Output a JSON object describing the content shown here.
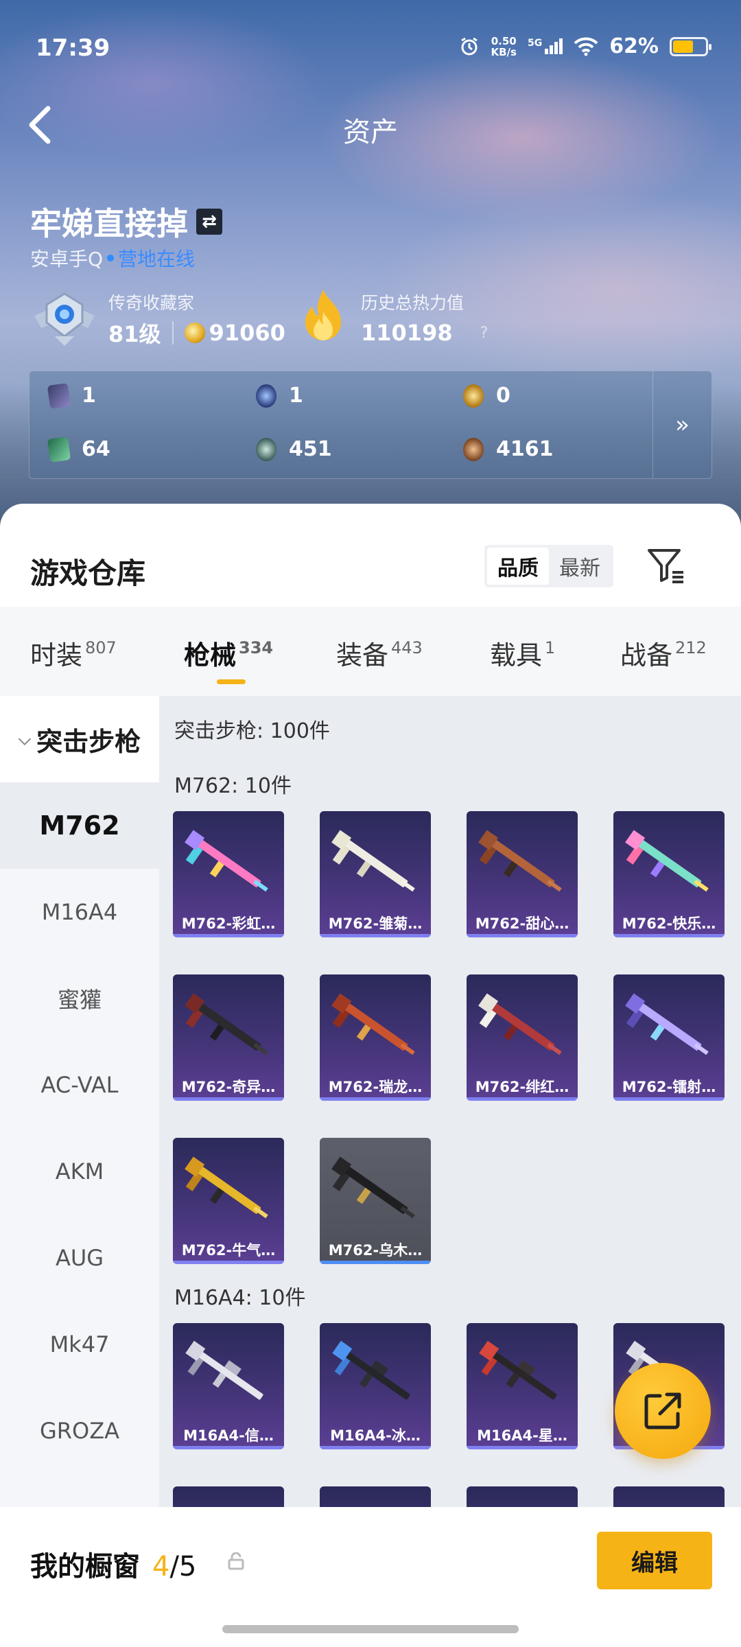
{
  "status": {
    "time": "17:39",
    "net_speed_top": "0.50",
    "net_speed_unit": "KB/s",
    "network": "5G",
    "battery": "62%"
  },
  "nav": {
    "title": "资产"
  },
  "profile": {
    "name": "牢娣直接掉",
    "platform": "安卓手Q",
    "status": "营地在线",
    "collector_label": "传奇收藏家",
    "level": "81级",
    "coins": "91060",
    "heat_label": "历史总热力值",
    "heat_value": "110198",
    "heat_help": "?"
  },
  "items": [
    {
      "icon": "card-icon",
      "value": "1"
    },
    {
      "icon": "orb-icon",
      "value": "1"
    },
    {
      "icon": "gold-orb-icon",
      "value": "0"
    },
    {
      "icon": "green-card-icon",
      "value": "64"
    },
    {
      "icon": "gem-icon",
      "value": "451"
    },
    {
      "icon": "bronze-orb-icon",
      "value": "4161"
    }
  ],
  "warehouse": {
    "title": "游戏仓库",
    "sort_options": [
      "品质",
      "最新"
    ],
    "sort_selected": "品质"
  },
  "tabs": [
    {
      "label": "时装",
      "count": "807"
    },
    {
      "label": "枪械",
      "count": "334"
    },
    {
      "label": "装备",
      "count": "443"
    },
    {
      "label": "载具",
      "count": "1"
    },
    {
      "label": "战备",
      "count": "212"
    }
  ],
  "side": {
    "group": "突击步枪",
    "items": [
      "M762",
      "M16A4",
      "蜜獾",
      "AC-VAL",
      "AKM",
      "AUG",
      "Mk47",
      "GROZA"
    ]
  },
  "content": {
    "count_line": "突击步枪: 100件",
    "sections": [
      {
        "heading": "M762: 10件",
        "cards": [
          "M762-彩虹…",
          "M762-雏菊…",
          "M762-甜心…",
          "M762-快乐…",
          "M762-奇异…",
          "M762-瑞龙…",
          "M762-绯红…",
          "M762-镭射…",
          "M762-牛气…",
          "M762-乌木…"
        ]
      },
      {
        "heading": "M16A4: 10件",
        "cards": [
          "M16A4-信…",
          "M16A4-冰…",
          "M16A4-星…",
          ""
        ]
      }
    ]
  },
  "bottom": {
    "label": "我的橱窗",
    "current": "4",
    "total": "/5",
    "edit": "编辑"
  },
  "colors": {
    "accent": "#f6b315",
    "online": "#3b8bff",
    "card_bg": "#46357a"
  }
}
